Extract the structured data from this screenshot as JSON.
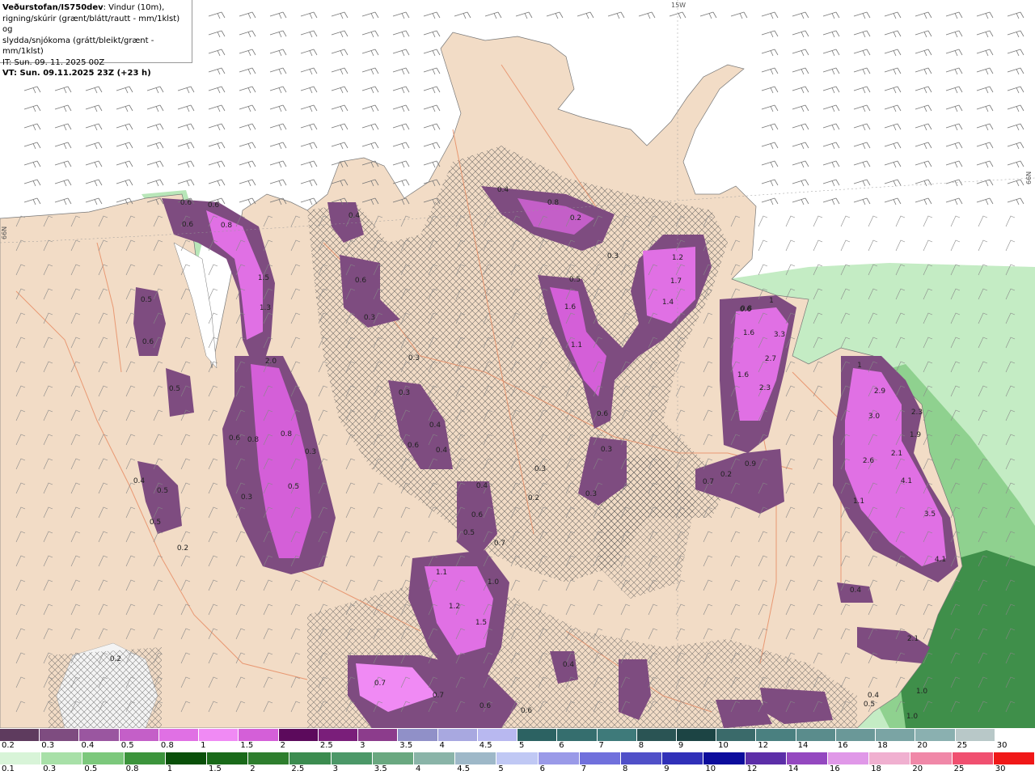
{
  "header": {
    "source": "Veðurstofan/IS750dev",
    "line1_rest": ": Vindur (10m),",
    "line2": "rigning/skúrir (grænt/blátt/rautt - mm/1klst) og",
    "line3": "slydda/snjókoma (grátt/bleikt/grænt - mm/1klst)",
    "init_time": "IT: Sun. 09. 11. 2025 00Z",
    "valid_time": "VT: Sun. 09.11.2025 23Z (+23 h)"
  },
  "graticule_labels": {
    "lon_top": "15W",
    "lat_left": "66N",
    "lat_right": "66N"
  },
  "map_labels": [
    {
      "text": "0.4"
    },
    {
      "text": "0.8"
    },
    {
      "text": "0.2"
    },
    {
      "text": "0.6"
    },
    {
      "text": "0.6"
    },
    {
      "text": "0.8"
    },
    {
      "text": "0.4"
    },
    {
      "text": "0.6"
    },
    {
      "text": "0.3"
    },
    {
      "text": "1.5"
    },
    {
      "text": "1.3"
    },
    {
      "text": "2.0"
    },
    {
      "text": "0.5"
    },
    {
      "text": "0.6"
    },
    {
      "text": "0.6"
    },
    {
      "text": "0.5"
    },
    {
      "text": "0.6"
    },
    {
      "text": "0.8"
    },
    {
      "text": "0.8"
    },
    {
      "text": "0.3"
    },
    {
      "text": "0.5"
    },
    {
      "text": "0.3"
    },
    {
      "text": "0.5"
    },
    {
      "text": "0.4"
    },
    {
      "text": "0.5"
    },
    {
      "text": "0.2"
    },
    {
      "text": "0.3"
    },
    {
      "text": "0.3"
    },
    {
      "text": "0.4"
    },
    {
      "text": "0.6"
    },
    {
      "text": "0.4"
    },
    {
      "text": "0.4"
    },
    {
      "text": "0.6"
    },
    {
      "text": "0.5"
    },
    {
      "text": "0.7"
    },
    {
      "text": "1.1"
    },
    {
      "text": "1.0"
    },
    {
      "text": "1.2"
    },
    {
      "text": "1.5"
    },
    {
      "text": "0.7"
    },
    {
      "text": "0.7"
    },
    {
      "text": "0.6"
    },
    {
      "text": "0.6"
    },
    {
      "text": "0.4"
    },
    {
      "text": "0.3"
    },
    {
      "text": "0.5"
    },
    {
      "text": "1.6"
    },
    {
      "text": "1.1"
    },
    {
      "text": "0.6"
    },
    {
      "text": "0.3"
    },
    {
      "text": "0.3"
    },
    {
      "text": "0.3"
    },
    {
      "text": "0.2"
    },
    {
      "text": "1.2"
    },
    {
      "text": "1.7"
    },
    {
      "text": "1.4"
    },
    {
      "text": "0.6"
    },
    {
      "text": "1.6"
    },
    {
      "text": "3.3"
    },
    {
      "text": "2.7"
    },
    {
      "text": "1.6"
    },
    {
      "text": "2.3"
    },
    {
      "text": "0.9"
    },
    {
      "text": "0.7"
    },
    {
      "text": "0.2"
    },
    {
      "text": "2.9"
    },
    {
      "text": "3.0"
    },
    {
      "text": "2.3"
    },
    {
      "text": "1.9"
    },
    {
      "text": "2.6"
    },
    {
      "text": "2.1"
    },
    {
      "text": "4.1"
    },
    {
      "text": "1.1"
    },
    {
      "text": "3.5"
    },
    {
      "text": "4.1"
    },
    {
      "text": "0.4"
    },
    {
      "text": "2.1"
    },
    {
      "text": "0.4"
    },
    {
      "text": "0.5"
    },
    {
      "text": "1.0"
    },
    {
      "text": "1.0"
    },
    {
      "text": "0.2"
    },
    {
      "text": "1"
    },
    {
      "text": "0.8"
    },
    {
      "text": "1"
    }
  ],
  "legend_snow": {
    "labels": [
      "0.2",
      "0.3",
      "0.4",
      "0.5",
      "0.8",
      "1",
      "1.5",
      "2",
      "2.5",
      "3",
      "3.5",
      "4",
      "4.5",
      "5",
      "6",
      "7",
      "8",
      "9",
      "10",
      "12",
      "14",
      "16",
      "18",
      "20",
      "25",
      "30"
    ],
    "colors": [
      "#5e3b5e",
      "#7e4c80",
      "#9a56a0",
      "#c45fc8",
      "#e070e4",
      "#f08af4",
      "#d45fd8",
      "#5c0a5c",
      "#7a1e7a",
      "#8c3c8c",
      "#9090c8",
      "#a8a8e0",
      "#b8b8f0",
      "#2c6262",
      "#356e6e",
      "#3e7a7a",
      "#2a5454",
      "#1c4444",
      "#3a6a6a",
      "#4a8080",
      "#5a8c8c",
      "#6a9898",
      "#7aa4a4",
      "#8ab0b0",
      "#b8c8c8",
      "#ffffff"
    ]
  },
  "legend_rain": {
    "labels": [
      "0.1",
      "0.3",
      "0.5",
      "0.8",
      "1",
      "1.5",
      "2",
      "2.5",
      "3",
      "3.5",
      "4",
      "4.5",
      "5",
      "6",
      "7",
      "8",
      "9",
      "10",
      "12",
      "14",
      "16",
      "18",
      "20",
      "25",
      "30"
    ],
    "colors": [
      "#d8f4d8",
      "#a8e0a8",
      "#7cc87c",
      "#3c943c",
      "#0a500a",
      "#1a6a1a",
      "#2e7e2e",
      "#3c8c50",
      "#4c9868",
      "#6aa880",
      "#8ab4a8",
      "#9eb8c8",
      "#c0c8f4",
      "#9a9ae8",
      "#7070dc",
      "#5050c8",
      "#3030b8",
      "#0c0c9c",
      "#5c2ea8",
      "#9448c0",
      "#e098e8",
      "#f0b0d0",
      "#f088a8",
      "#f05070",
      "#f01818"
    ]
  }
}
